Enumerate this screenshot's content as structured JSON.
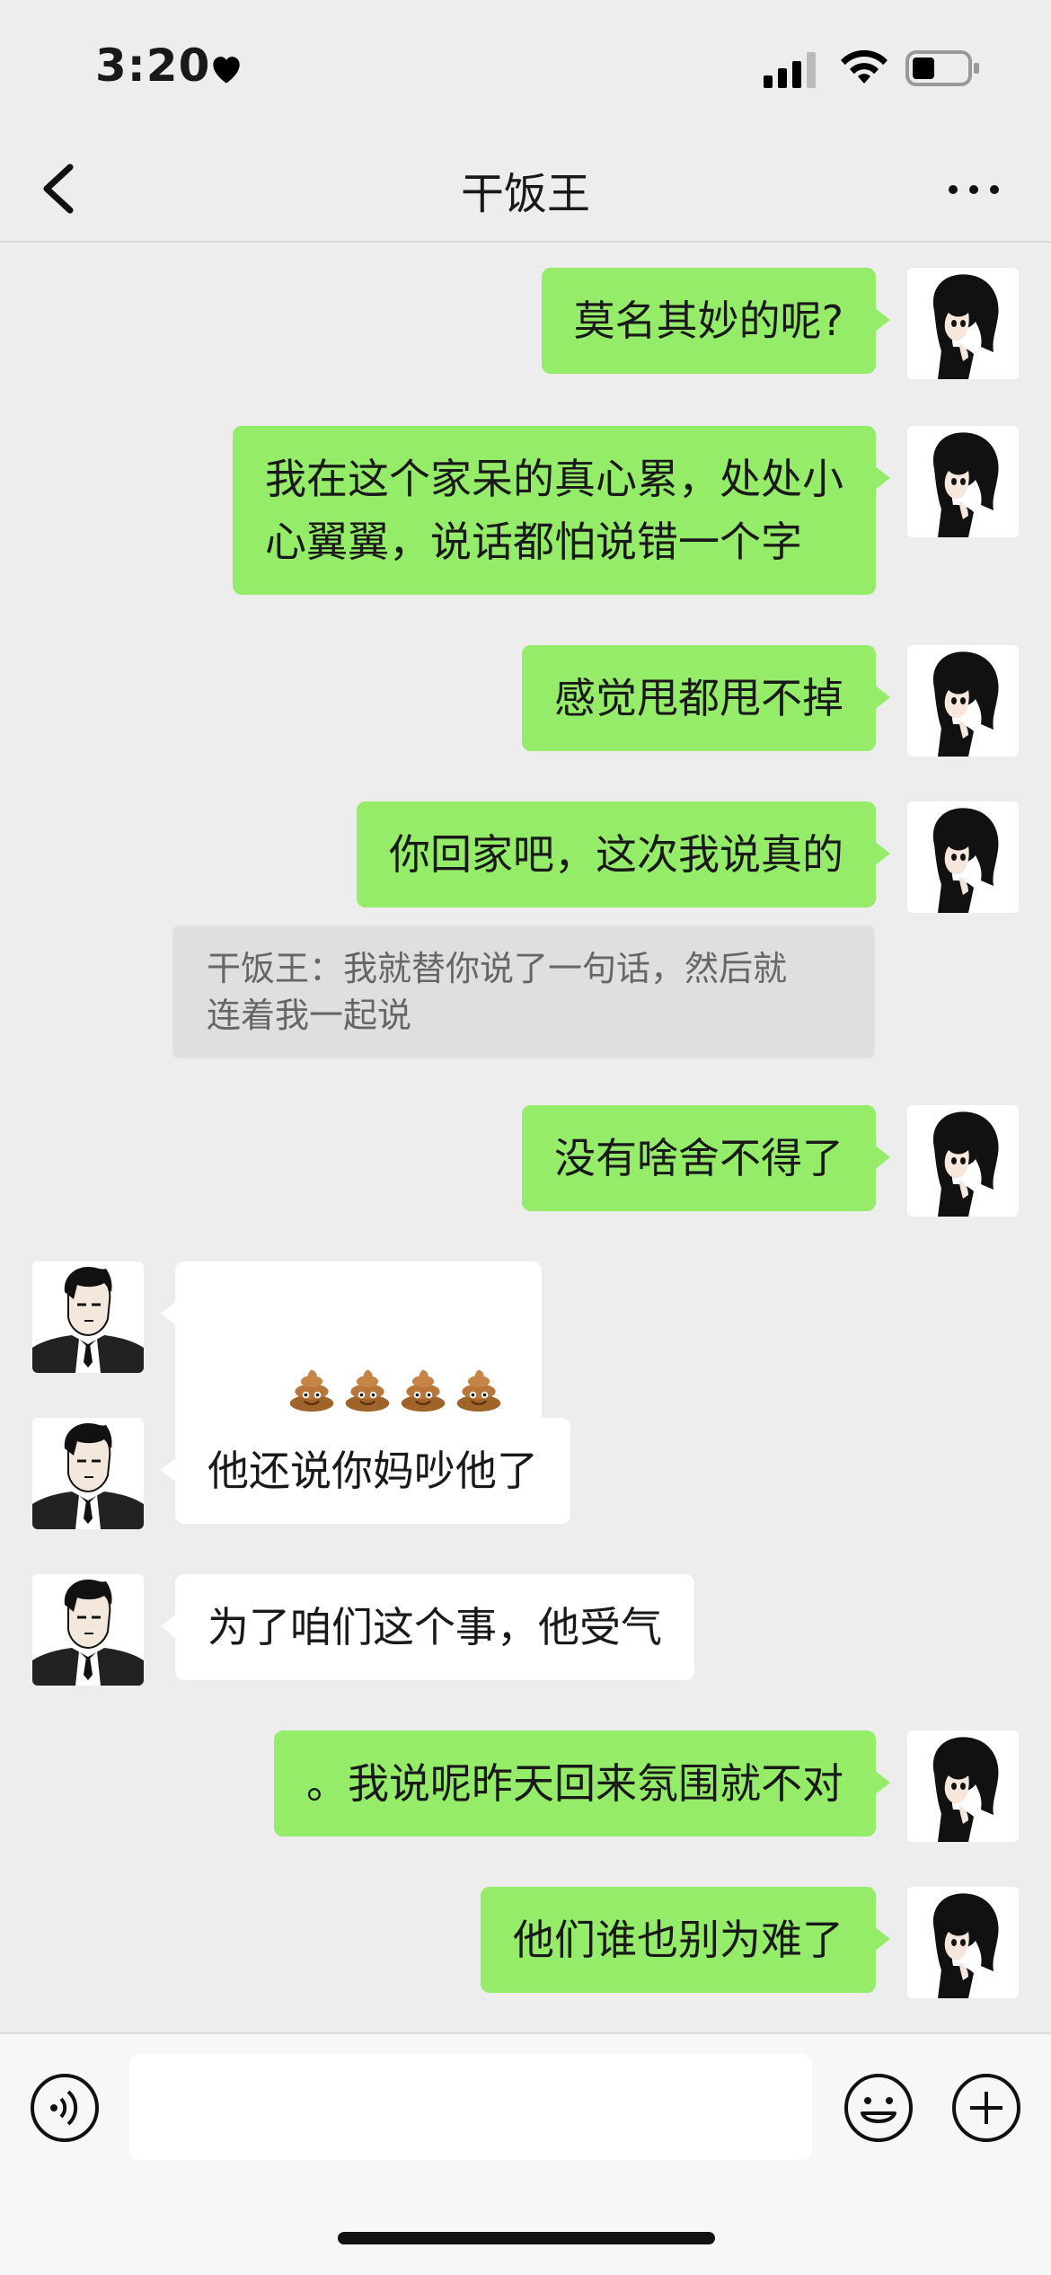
{
  "status_bar": {
    "time": "3:20"
  },
  "header": {
    "title": "干饭王"
  },
  "messages": [
    {
      "side": "me",
      "text": "莫名其妙的呢?"
    },
    {
      "side": "me",
      "text": "我在这个家呆的真心累，处处小\n心翼翼，说话都怕说错一个字"
    },
    {
      "side": "me",
      "text": "感觉甩都甩不掉"
    },
    {
      "side": "me",
      "text": "你回家吧，这次我说真的",
      "quote": "干饭王：我就替你说了一句话，然后就\n连着我一起说"
    },
    {
      "side": "me",
      "text": "没有啥舍不得了"
    },
    {
      "side": "them",
      "emoji": [
        "pile-of-poo",
        "pile-of-poo",
        "pile-of-poo",
        "pile-of-poo"
      ]
    },
    {
      "side": "them",
      "text": "他还说你妈吵他了"
    },
    {
      "side": "them",
      "text": "为了咱们这个事，他受气"
    },
    {
      "side": "me",
      "text": "。我说呢昨天回来氛围就不对"
    },
    {
      "side": "me",
      "text": "他们谁也别为难了"
    }
  ],
  "input_bar": {
    "value": ""
  },
  "colors": {
    "background": "#ededed",
    "my_bubble": "#95ec69",
    "their_bubble": "#ffffff",
    "quote_bg": "#dfdfdf"
  },
  "icons": [
    "heart-icon",
    "signal-icon",
    "wifi-icon",
    "battery-icon",
    "back-icon",
    "more-icon",
    "voice-icon",
    "emoji-icon",
    "plus-icon"
  ]
}
